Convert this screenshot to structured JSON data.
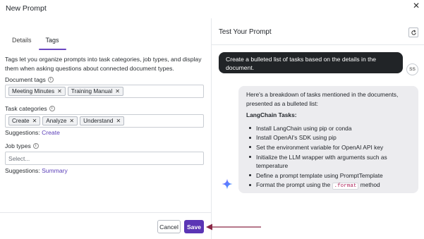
{
  "dialog": {
    "title": "New Prompt",
    "close_glyph": "✕"
  },
  "tabs": [
    {
      "label": "Details",
      "active": false
    },
    {
      "label": "Tags",
      "active": true
    }
  ],
  "description": "Tags let you organize prompts into task categories, job types, and display them when asking questions about connected document types.",
  "document_tags": {
    "label": "Document tags",
    "chips": [
      "Meeting Minutes",
      "Training Manual"
    ]
  },
  "task_categories": {
    "label": "Task categories",
    "chips": [
      "Create",
      "Analyze",
      "Understand"
    ],
    "suggestions_label": "Suggestions:",
    "suggestion": "Create"
  },
  "job_types": {
    "label": "Job types",
    "placeholder": "Select...",
    "value": "",
    "suggestions_label": "Suggestions:",
    "suggestion": "Summary"
  },
  "footer": {
    "cancel": "Cancel",
    "save": "Save"
  },
  "test_panel": {
    "title": "Test Your Prompt",
    "user_message": "Create a bulleted list of tasks based on the details in the document.",
    "user_initials": "SS",
    "response": {
      "intro": "Here's a breakdown of tasks mentioned in the documents, presented as a bulleted list:",
      "heading": "LangChain Tasks:",
      "items": [
        "Install LangChain using pip or conda",
        "Install OpenAI's SDK using pip",
        "Set the environment variable for OpenAI API key",
        "Initialize the LLM wrapper with arguments such as temperature",
        "Define a prompt template using PromptTemplate"
      ],
      "last_item_prefix": "Format the prompt using the",
      "last_item_code": ".format",
      "last_item_suffix": "method"
    }
  },
  "colors": {
    "accent": "#5b35b5",
    "user_bubble": "#212427",
    "bot_bubble": "#ececef",
    "annotation_arrow": "#8a2846"
  }
}
